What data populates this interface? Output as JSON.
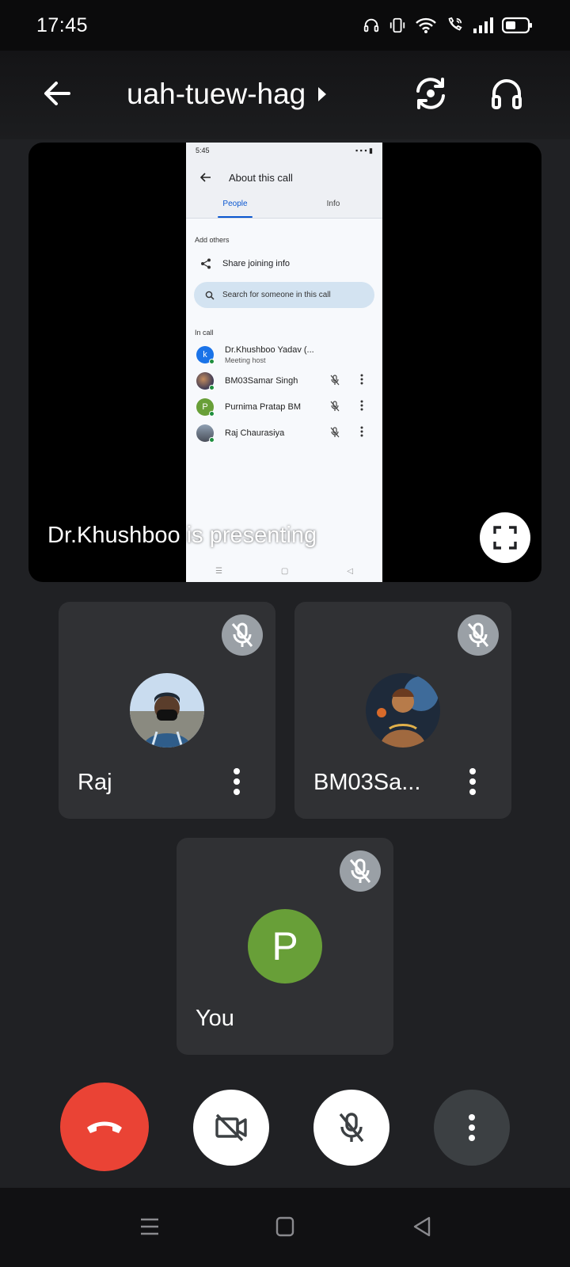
{
  "status_bar": {
    "time": "17:45",
    "icons": [
      "headset-icon",
      "vibrate-icon",
      "wifi-icon",
      "wifi-calling-icon",
      "signal-icon",
      "battery-icon"
    ]
  },
  "header": {
    "meeting_code": "uah-tuew-hag",
    "back_icon": "back-arrow-icon",
    "title_icon": "caret-right-icon",
    "switch_camera_icon": "switch-camera-icon",
    "audio_output_icon": "headphones-icon"
  },
  "presentation": {
    "presenting_label": "Dr.Khushboo is presenting",
    "fullscreen_icon": "fullscreen-icon",
    "shared_screen": {
      "status_time": "5:45",
      "header_title": "About this call",
      "tabs": [
        "People",
        "Info"
      ],
      "active_tab": "People",
      "add_others_label": "Add others",
      "share_label": "Share joining info",
      "search_placeholder": "Search for someone in this call",
      "in_call_label": "In call",
      "people": [
        {
          "initial": "k",
          "name": "Dr.Khushboo Yadav (...",
          "sub": "Meeting host",
          "color": "#1a73e8"
        },
        {
          "initial": "",
          "name": "BM03Samar Singh",
          "sub": "",
          "color": "#6b4b3a"
        },
        {
          "initial": "P",
          "name": "Purnima Pratap BM",
          "sub": "",
          "color": "#689f38"
        },
        {
          "initial": "",
          "name": "Raj Chaurasiya",
          "sub": "",
          "color": "#5f6f82"
        }
      ]
    }
  },
  "participants": [
    {
      "name": "Raj",
      "muted": true
    },
    {
      "name": "BM03Sa...",
      "muted": true
    },
    {
      "name": "You",
      "initial": "P",
      "muted": true,
      "avatar_color": "#689f38"
    }
  ],
  "controls": {
    "end_call_icon": "end-call-icon",
    "camera_icon": "camera-off-icon",
    "mic_icon": "mic-off-icon",
    "more_icon": "more-vert-icon",
    "end_call_color": "#ea4335"
  },
  "nav_bar": {
    "items": [
      "menu-icon",
      "home-icon",
      "back-icon"
    ]
  }
}
